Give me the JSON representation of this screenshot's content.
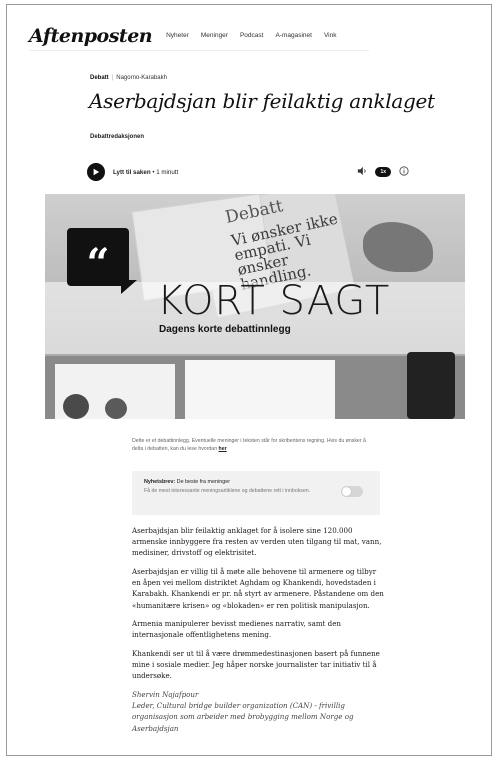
{
  "header": {
    "logo": "Aftenposten",
    "nav": [
      "Nyheter",
      "Meninger",
      "Podcast",
      "A-magasinet",
      "Vink"
    ]
  },
  "article": {
    "section": "Debatt",
    "topic": "Nagorno-Karabakh",
    "headline": "Aserbajdsjan blir feilaktig anklaget",
    "byline": "Debattredaksjonen"
  },
  "audio": {
    "label_bold": "Lytt til saken",
    "duration": " • 1 minutt",
    "speed": "1x"
  },
  "hero": {
    "paper_title": "Debatt",
    "paper_text": "Vi ønsker ikke empati. Vi ønsker handling.",
    "big_title": "KORT SAGT",
    "subtitle": "Dagens korte debattinnlegg",
    "quote_mark": "“"
  },
  "notice": {
    "text": "Dette er et debattinnlegg. Eventuelle meninger i teksten står for skribentens regning. Hvis du ønsker å delta i debatten, kan du lese hvordan",
    "link": "her"
  },
  "newsletter": {
    "title_bold": "Nyhetsbrev:",
    "title_rest": " De beste fra meninger",
    "description": "Få de mest interessante meningsartiklene og debattene rett i innboksen."
  },
  "body": {
    "paragraphs": [
      "Aserbajdsjan blir feilaktig anklaget for å isolere sine 120.000 armenske innbyggere fra resten av verden uten tilgang til mat, vann, medisiner, drivstoff og elektrisitet.",
      "Aserbajdsjan er villig til å møte alle behovene til armenere og tilbyr en åpen vei mellom distriktet Aghdam og Khankendi, hovedstaden i Karabakh. Khankendi er pr. nå styrt av armenere. Påstandene om den «humanitære krisen» og «blokaden» er ren politisk manipulasjon.",
      "Armenia manipulerer bevisst medienes narrativ, samt den internasjonale offentlighetens mening.",
      "Khankendi ser ut til å være drømmedestinasjonen basert på funnene mine i sosiale medier. Jeg håper norske journalister tar initiativ til å undersøke."
    ],
    "signature_name": "Shervin Najafpour",
    "signature_title": "Leder, Cultural bridge builder organization (CAN) - frivillig organisasjon som arbeider med brobygging mellom Norge og Aserbajdsjan"
  }
}
